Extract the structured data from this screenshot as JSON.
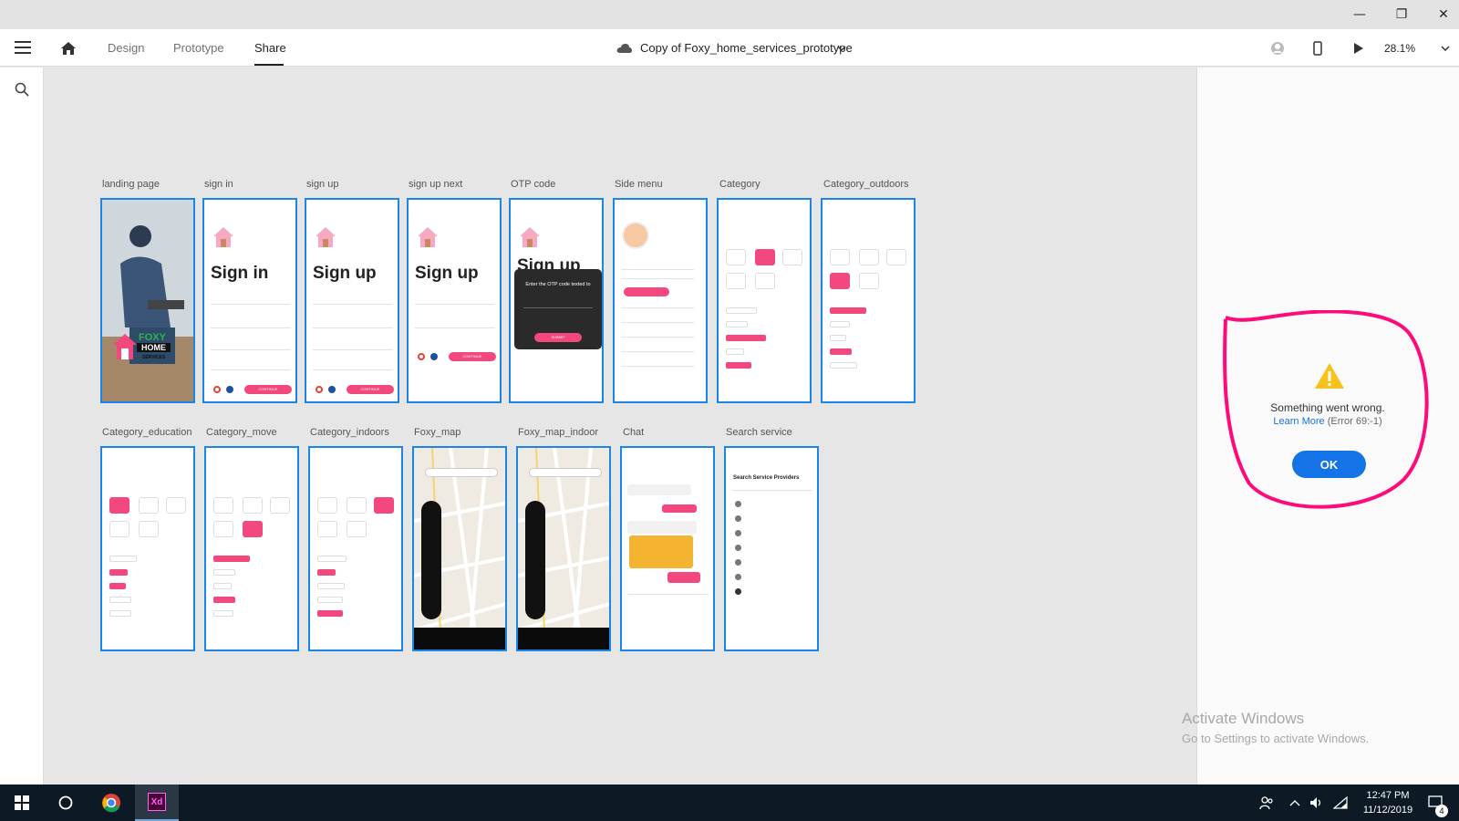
{
  "window": {
    "minimize": "—",
    "restore": "❐",
    "close": "✕"
  },
  "appbar": {
    "tabs": [
      {
        "label": "Design"
      },
      {
        "label": "Prototype"
      },
      {
        "label": "Share"
      }
    ],
    "doc_title": "Copy of Foxy_home_services_prototype",
    "zoom": "28.1%"
  },
  "artboards": {
    "row1": [
      "landing page",
      "sign in",
      "sign up",
      "sign up  next",
      "OTP code",
      "Side menu",
      "Category",
      "Category_outdoors"
    ],
    "row2": [
      "Category_education",
      "Category_move",
      "Category_indoors",
      "Foxy_map",
      "Foxy_map_indoor",
      "Chat",
      "Search service"
    ],
    "signin_title": "Sign in",
    "signup_title": "Sign up",
    "otp_title": "Sign up",
    "otp_text": "Enter the OTP code texted to",
    "brand_foxy": "FOXY",
    "brand_home": "HOME",
    "brand_services": "SERVICES",
    "continue": "CONTINUE",
    "submit": "SUBMIT",
    "search_providers": "Search Service Providers"
  },
  "dialog": {
    "message": "Something went wrong.",
    "learn_more": "Learn More",
    "error_code": "(Error 69:-1)",
    "ok": "OK"
  },
  "watermark": {
    "line1": "Activate Windows",
    "line2": "Go to Settings to activate Windows."
  },
  "taskbar": {
    "time": "12:47 PM",
    "date": "11/12/2019",
    "notifications": "4",
    "xd_label": "Xd"
  },
  "colors": {
    "accent_pink": "#f2487e",
    "artboard_border": "#1a86e8",
    "ok_button": "#1473e6",
    "annotation": "#ff0a7a"
  }
}
